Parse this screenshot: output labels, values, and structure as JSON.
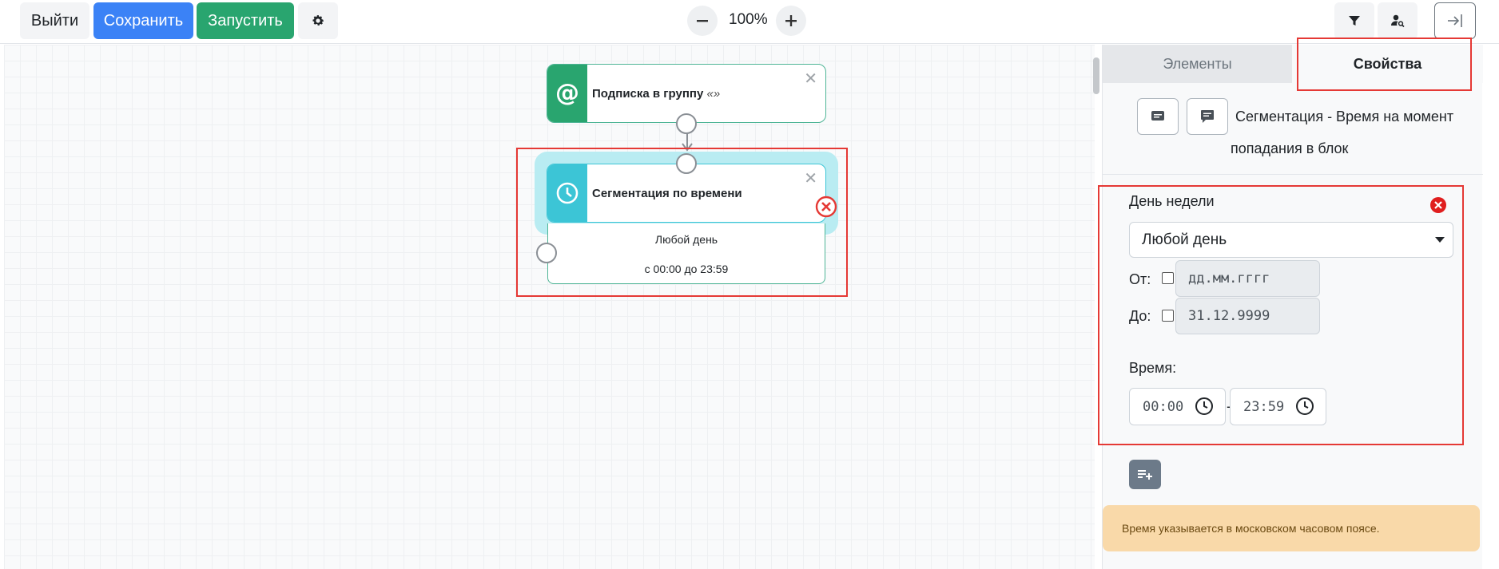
{
  "toolbar": {
    "exit_label": "Выйти",
    "save_label": "Сохранить",
    "run_label": "Запустить",
    "zoom_level": "100%"
  },
  "canvas": {
    "node_subscription": {
      "title": "Подписка в группу",
      "suffix": "«»",
      "icon": "at-icon"
    },
    "node_segmentation": {
      "title": "Сегментация по времени",
      "icon": "clock-icon",
      "day_text": "Любой день",
      "time_text": "с 00:00 до 23:59"
    }
  },
  "panel": {
    "tabs": [
      "Элементы",
      "Свойства"
    ],
    "active_tab": "Свойства",
    "header_text": "Сегментация - Время на момент попадания в блок",
    "day_label": "День недели",
    "day_value": "Любой день",
    "from_label": "От:",
    "from_placeholder": "дд.мм.гггг",
    "to_label": "До:",
    "to_value": "31.12.9999",
    "time_label": "Время:",
    "time_from": "00:00",
    "time_separator": "-",
    "time_to": "23:59",
    "notice": "Время указывается в московском часовом поясе."
  },
  "colors": {
    "primary": "#3b82f6",
    "success": "#29a56f",
    "info": "#3cc5d6",
    "highlight": "#e53935",
    "warning_bg": "#f9d9a9"
  }
}
